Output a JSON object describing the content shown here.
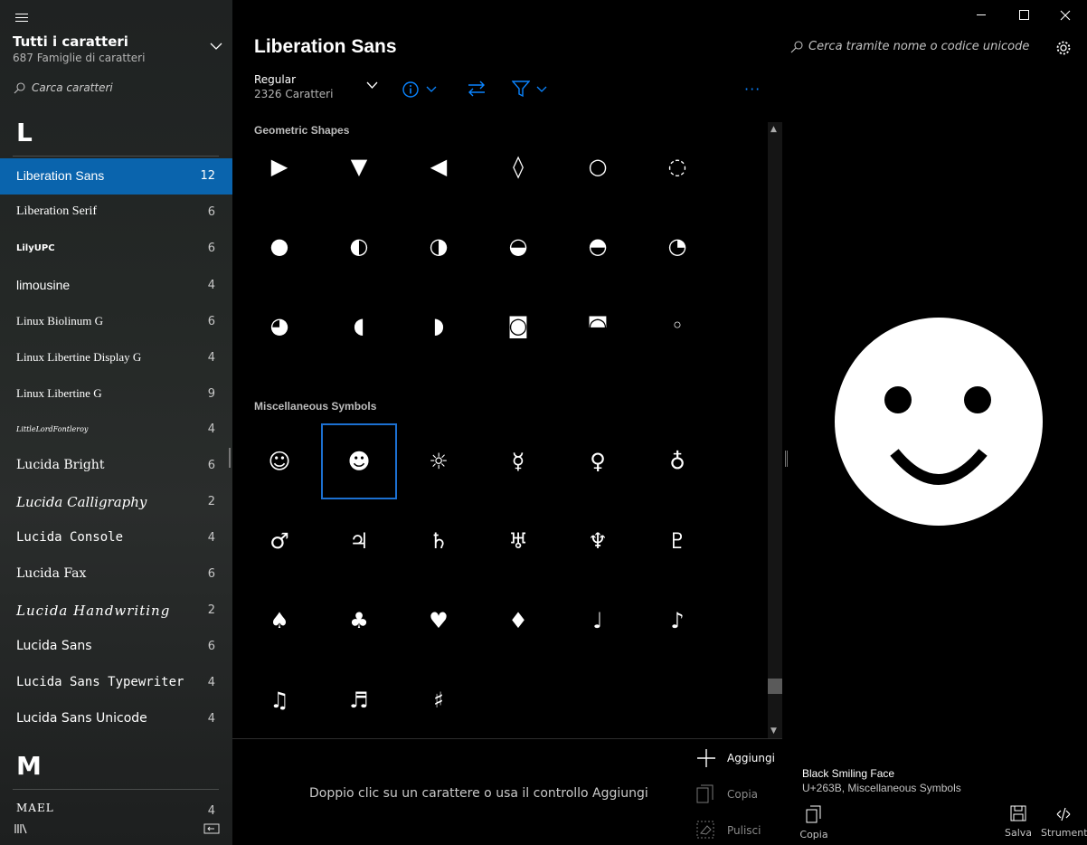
{
  "sidebar": {
    "title": "Tutti i caratteri",
    "subtitle": "687 Famiglie di caratteri",
    "search_placeholder": "Carca caratteri",
    "letters": [
      "L",
      "M"
    ],
    "fonts": [
      {
        "name": "Liberation Sans",
        "count": "12"
      },
      {
        "name": "Liberation Serif",
        "count": "6"
      },
      {
        "name": "LilyUPC",
        "count": "6"
      },
      {
        "name": "limousine",
        "count": "4"
      },
      {
        "name": "Linux Biolinum G",
        "count": "6"
      },
      {
        "name": "Linux Libertine Display G",
        "count": "4"
      },
      {
        "name": "Linux Libertine G",
        "count": "9"
      },
      {
        "name": "LittleLordFontleroy",
        "count": "4"
      },
      {
        "name": "Lucida Bright",
        "count": "6"
      },
      {
        "name": "Lucida Calligraphy",
        "count": "2"
      },
      {
        "name": "Lucida Console",
        "count": "4"
      },
      {
        "name": "Lucida Fax",
        "count": "6"
      },
      {
        "name": "Lucida Handwriting",
        "count": "2"
      },
      {
        "name": "Lucida Sans",
        "count": "6"
      },
      {
        "name": "Lucida Sans Typewriter",
        "count": "4"
      },
      {
        "name": "Lucida Sans Unicode",
        "count": "4"
      },
      {
        "name": "MAEL",
        "count": "4"
      }
    ]
  },
  "main": {
    "family": "Liberation Sans",
    "style": "Regular",
    "char_count": "2326 Caratteri",
    "more": "···",
    "sections": [
      {
        "label": "Geometric Shapes",
        "glyphs": [
          "▶",
          "▼",
          "◀",
          "◊",
          "○",
          "◌",
          "●",
          "◐",
          "◑",
          "◒",
          "◓",
          "◔",
          "◕",
          "◖",
          "◗",
          "◙",
          "◚",
          "◦"
        ]
      },
      {
        "label": "Miscellaneous Symbols",
        "glyphs": [
          "☺",
          "☻",
          "☼",
          "☿",
          "♀",
          "♁",
          "♂",
          "♃",
          "♄",
          "♅",
          "♆",
          "♇",
          "♠",
          "♣",
          "♥",
          "♦",
          "♩",
          "♪",
          "♫",
          "♬",
          "♯"
        ]
      }
    ],
    "hint": "Doppio clic su un carattere o usa il controllo Aggiungi",
    "actions": {
      "add": "Aggiungi",
      "copy": "Copia",
      "clear": "Pulisci"
    }
  },
  "right": {
    "search_placeholder": "Cerca tramite nome o codice unicode",
    "preview_glyph": "☻",
    "char_name": "Black Smiling Face",
    "char_code": "U+263B, Miscellaneous Symbols",
    "buttons": {
      "copy": "Copia",
      "save": "Salva",
      "tools": "Strumenti"
    }
  },
  "colors": {
    "accent": "#0a64ad",
    "selection_border": "#1c70d1",
    "toolbar_icon": "#0a84ff"
  }
}
